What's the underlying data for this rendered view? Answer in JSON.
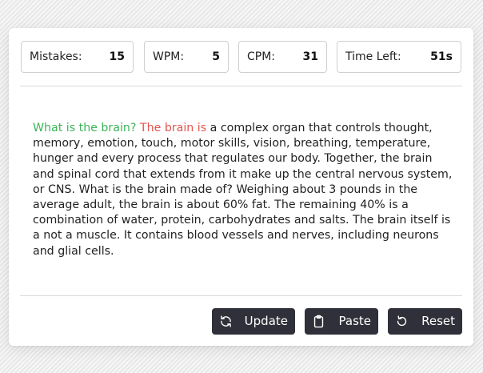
{
  "stats": {
    "mistakes": {
      "label": "Mistakes:",
      "value": "15"
    },
    "wpm": {
      "label": "WPM:",
      "value": "5"
    },
    "cpm": {
      "label": "CPM:",
      "value": "31"
    },
    "time_left": {
      "label": "Time Left:",
      "value": "51s"
    }
  },
  "paragraph": {
    "correct_text": "What is the brain?",
    "incorrect_text": " The brain is",
    "pending_text": " a complex organ that controls thought, memory, emotion, touch, motor skills, vision, breathing, temperature, hunger and every process that regulates our body. Together, the brain and spinal cord that extends from it make up the central nervous system, or CNS. What is the brain made of? Weighing about 3 pounds in the average adult, the brain is about 60% fat. The remaining 40% is a combination of water, protein, carbohydrates and salts. The brain itself is a not a muscle. It contains blood vessels and nerves, including neurons and glial cells."
  },
  "buttons": {
    "update": {
      "label": "Update",
      "icon": "refresh-icon"
    },
    "paste": {
      "label": "Paste",
      "icon": "clipboard-icon"
    },
    "reset": {
      "label": "Reset",
      "icon": "rotate-ccw-icon"
    }
  },
  "colors": {
    "correct": "#3cb457",
    "incorrect": "#e5544f",
    "button_bg": "#2f3039"
  }
}
